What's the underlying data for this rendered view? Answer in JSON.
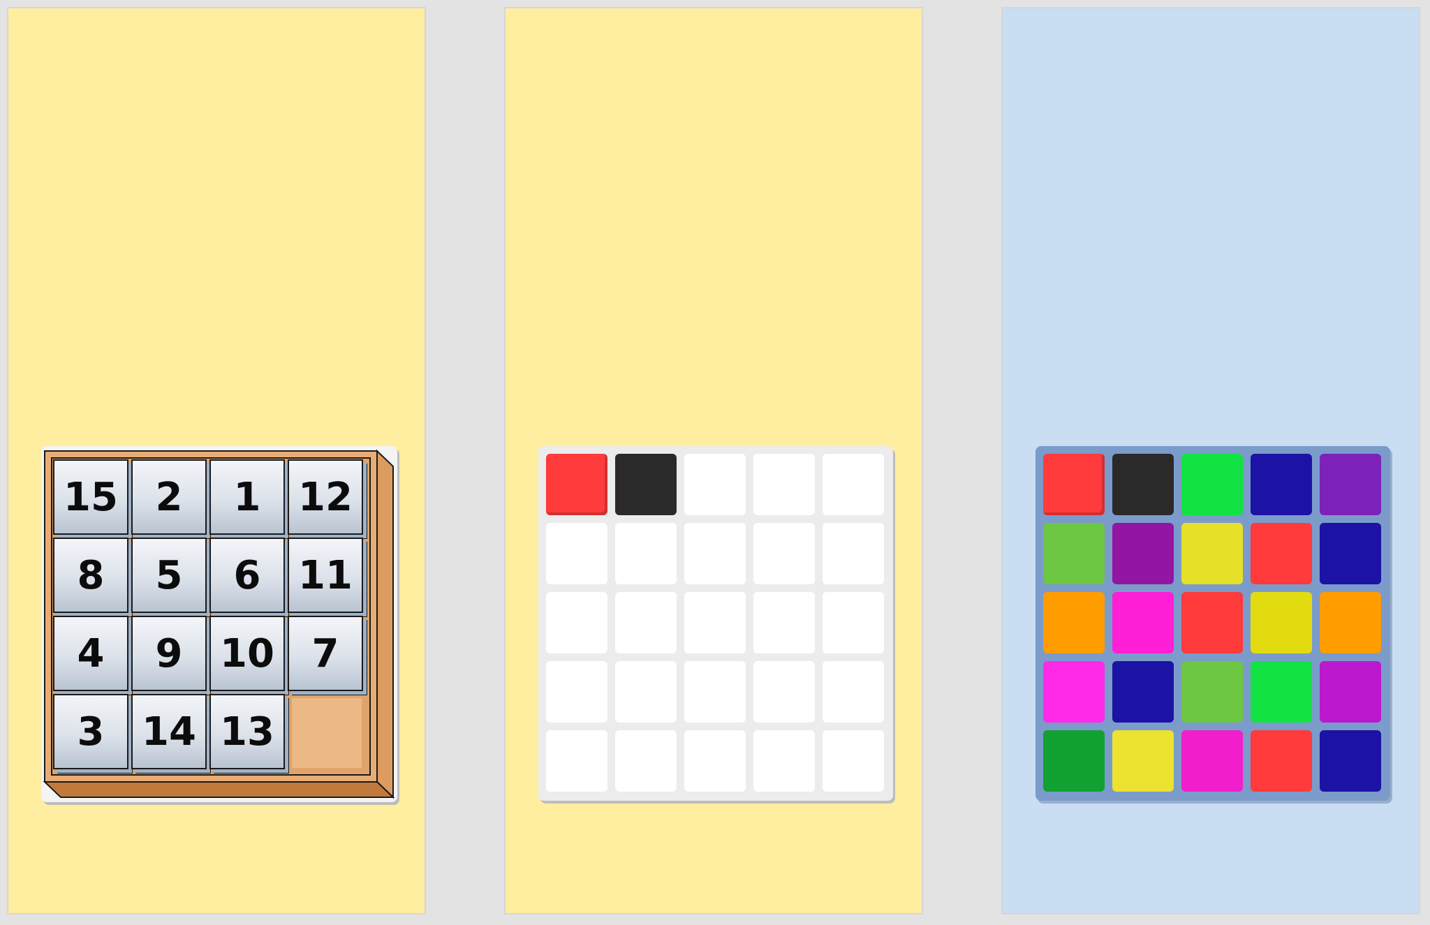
{
  "puzzle": {
    "tiles": [
      [
        "15",
        "2",
        "1",
        "12"
      ],
      [
        "8",
        "5",
        "6",
        "11"
      ],
      [
        "4",
        "9",
        "10",
        "7"
      ],
      [
        "3",
        "14",
        "13",
        ""
      ]
    ],
    "empty_position": {
      "row": 3,
      "col": 3
    },
    "colors": {
      "board": "#e8ad74",
      "board_dark": "#c27a3c",
      "empty_slot": "#ecb885",
      "tile_shadow": "#9fb2c8"
    }
  },
  "pattern_grid": {
    "cells": [
      [
        "#ff3b3b",
        "#2a2a2a",
        "#ffffff",
        "#ffffff",
        "#ffffff"
      ],
      [
        "#ffffff",
        "#ffffff",
        "#ffffff",
        "#ffffff",
        "#ffffff"
      ],
      [
        "#ffffff",
        "#ffffff",
        "#ffffff",
        "#ffffff",
        "#ffffff"
      ],
      [
        "#ffffff",
        "#ffffff",
        "#ffffff",
        "#ffffff",
        "#ffffff"
      ],
      [
        "#ffffff",
        "#ffffff",
        "#ffffff",
        "#ffffff",
        "#ffffff"
      ]
    ],
    "selected": {
      "row": 0,
      "col": 0
    }
  },
  "target_grid": {
    "cells": [
      [
        "#ff3b3b",
        "#2a2a2a",
        "#12e242",
        "#1c12a4",
        "#7d22b9"
      ],
      [
        "#6dc742",
        "#9316a3",
        "#e6e028",
        "#ff3b3b",
        "#1c12a4"
      ],
      [
        "#ff9c00",
        "#ff1fd6",
        "#ff3b3b",
        "#e2db10",
        "#ff9c00"
      ],
      [
        "#ff2ae8",
        "#1c12a4",
        "#6dc742",
        "#12e242",
        "#bc18cd"
      ],
      [
        "#11a133",
        "#ebe330",
        "#f01fcb",
        "#ff3b3b",
        "#1c12a4"
      ]
    ],
    "selected": {
      "row": 0,
      "col": 0
    }
  },
  "colors": {
    "page_background": "#e3e3e3",
    "left_panel": "#ffeda0",
    "middle_panel": "#ffeda0",
    "right_panel": "#c9ddf3"
  }
}
